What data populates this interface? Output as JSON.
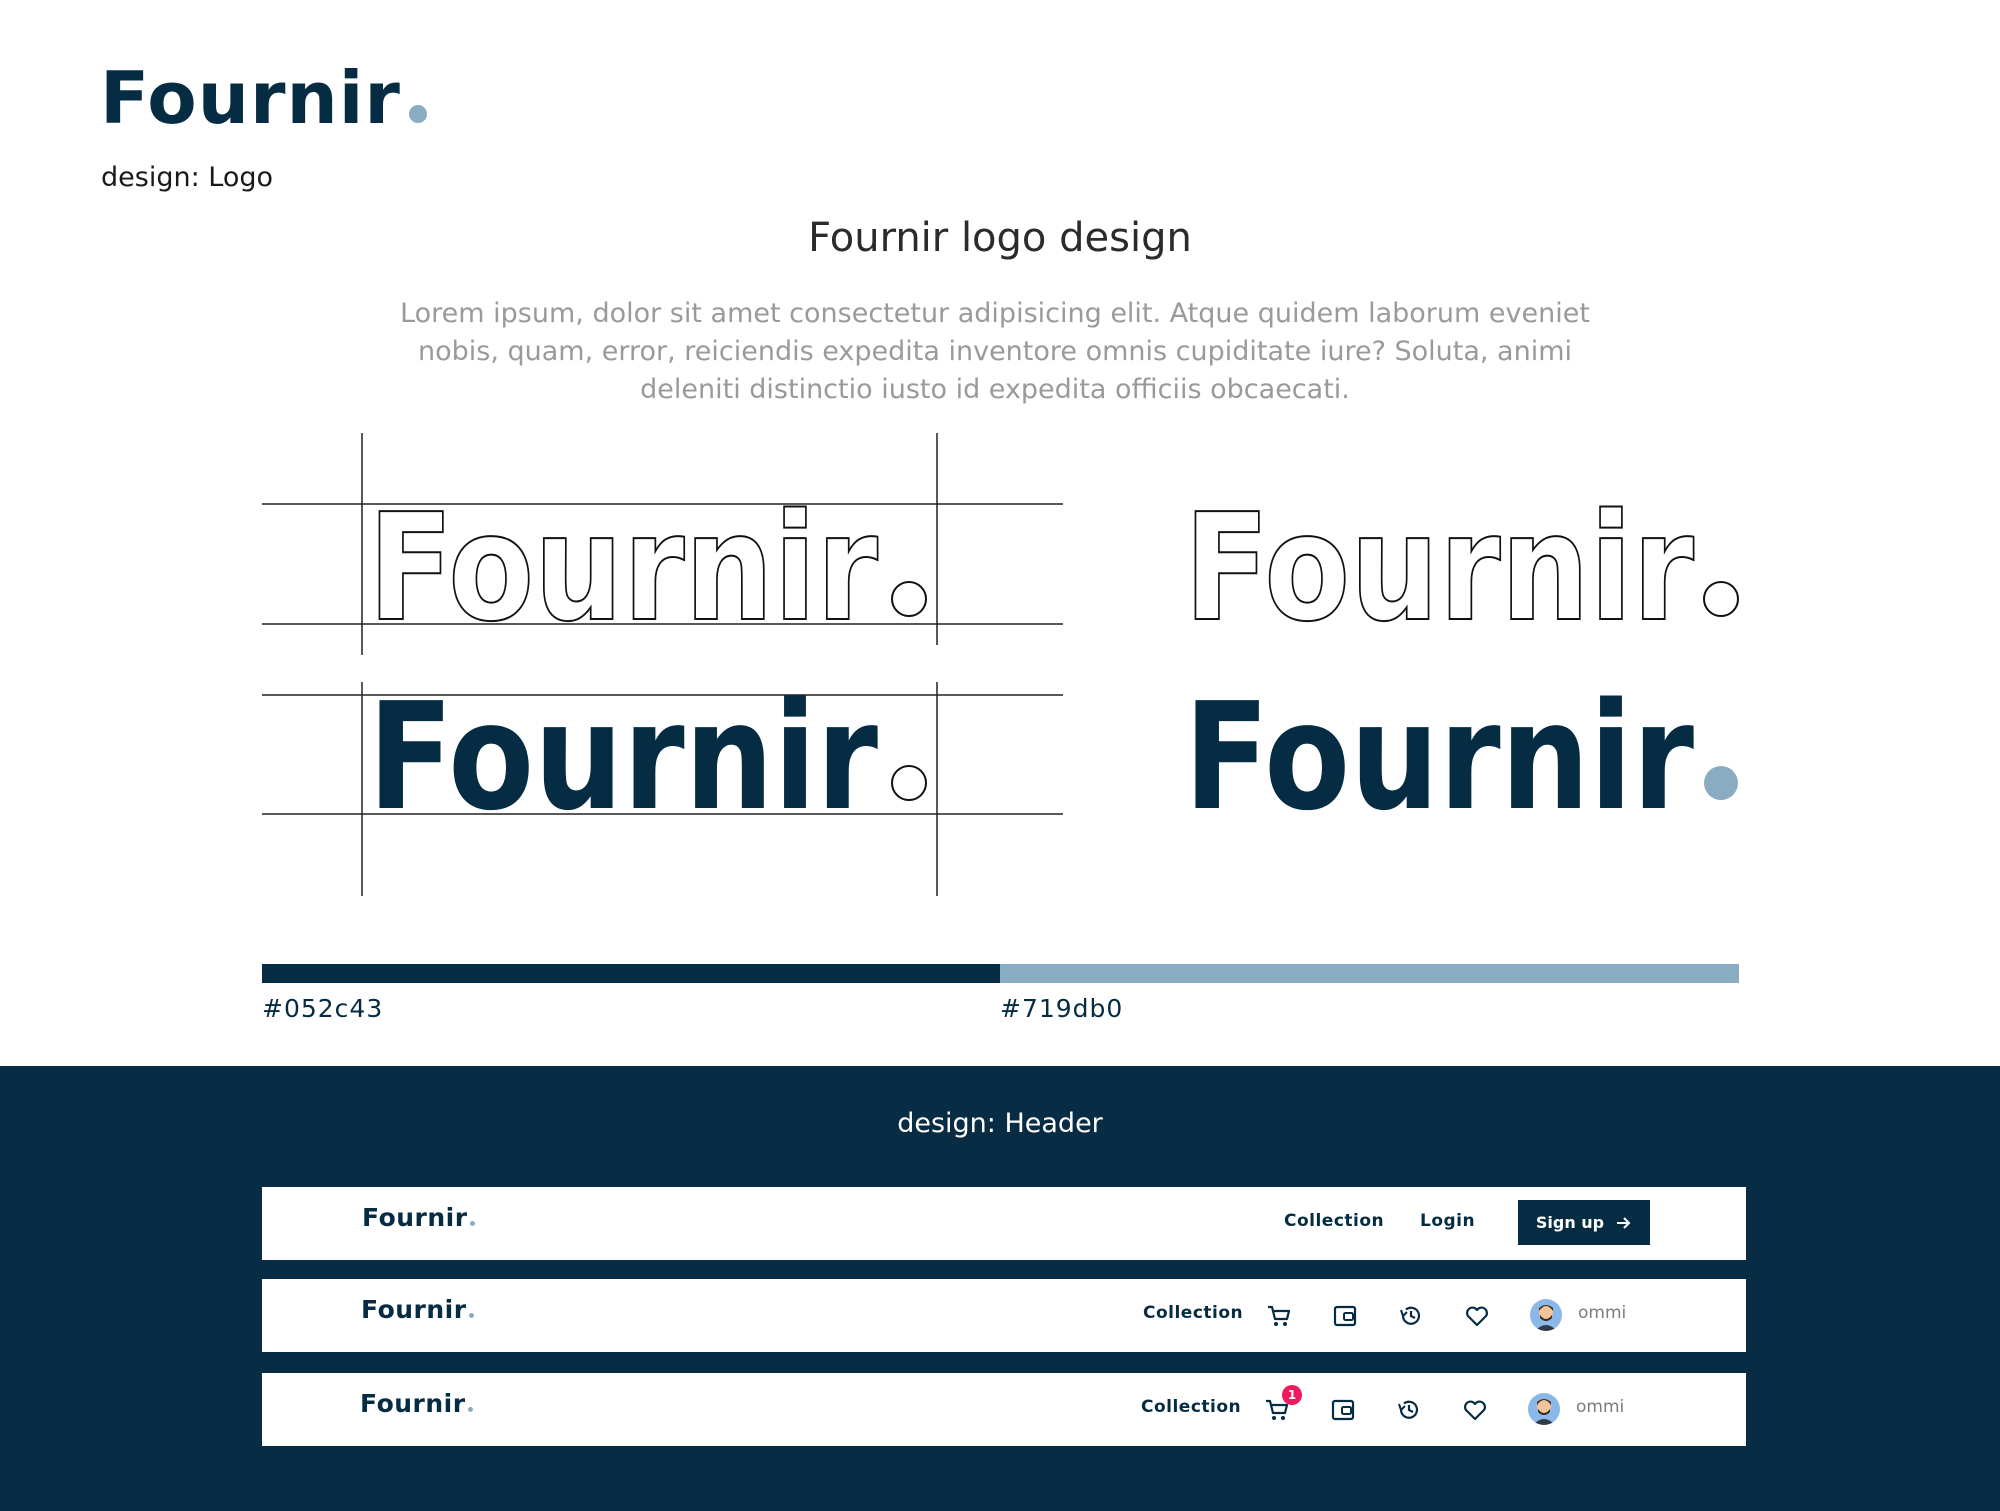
{
  "brand": {
    "name": "Fournir"
  },
  "logo_section": {
    "label": "design: Logo",
    "title": "Fournir logo design",
    "intro": "Lorem ipsum, dolor sit amet consectetur  adipisicing elit. Atque quidem laborum eveniet nobis, quam, error, reiciendis expedita inventore omnis cupiditate iure? Soluta, animi deleniti distinctio iusto id expedita officiis obcaecati."
  },
  "palette": [
    {
      "hex_label": "#052c43",
      "color": "#052c43"
    },
    {
      "hex_label": "#719db0",
      "color": "#8aacc3"
    }
  ],
  "header_section": {
    "label": "design: Header",
    "bar1": {
      "logo": "Fournir",
      "nav_collection": "Collection",
      "nav_login": "Login",
      "signup": "Sign up"
    },
    "bar2": {
      "logo": "Fournir",
      "nav_collection": "Collection",
      "username": "ommi",
      "icons": [
        "cart-icon",
        "wallet-icon",
        "history-icon",
        "heart-icon"
      ]
    },
    "bar3": {
      "logo": "Fournir",
      "nav_collection": "Collection",
      "username": "ommi",
      "cart_badge": "1",
      "icons": [
        "cart-icon",
        "wallet-icon",
        "history-icon",
        "heart-icon"
      ]
    }
  }
}
